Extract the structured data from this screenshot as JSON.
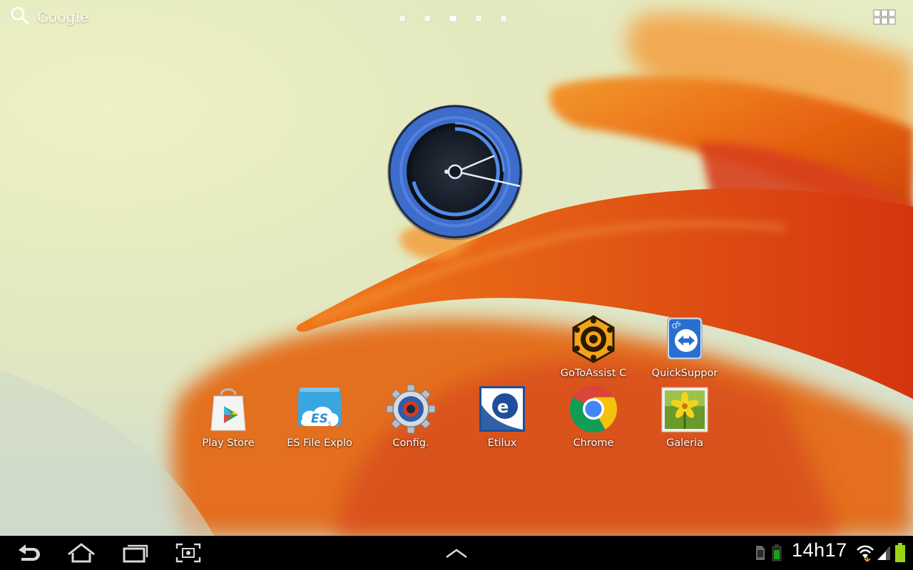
{
  "search": {
    "label": "Google",
    "icon": "search-icon"
  },
  "pager": {
    "page_count": 5,
    "active_index": 2
  },
  "apps_button": {
    "icon": "apps-grid-icon"
  },
  "clock_widget": {
    "icon": "analog-clock-icon",
    "accent": "#4a7fd8"
  },
  "apps": {
    "gotoassist": {
      "label": "GoToAssist C",
      "icon": "gotoassist-gear-icon"
    },
    "quicksupport": {
      "label": "QuickSuppor",
      "icon": "teamviewer-quicksupport-icon"
    },
    "play_store": {
      "label": "Play Store",
      "icon": "play-store-icon"
    },
    "es_file": {
      "label": "ES File Explo",
      "icon": "es-file-explorer-icon"
    },
    "config": {
      "label": "Config.",
      "icon": "settings-gear-icon"
    },
    "etilux": {
      "label": "Etilux",
      "icon": "etilux-icon"
    },
    "chrome": {
      "label": "Chrome",
      "icon": "chrome-icon"
    },
    "galeria": {
      "label": "Galeria",
      "icon": "gallery-icon"
    }
  },
  "system_bar": {
    "back": "back-icon",
    "home": "home-icon",
    "recents": "recent-apps-icon",
    "screenshot": "screenshot-icon",
    "app_drawer_arrow": "chevron-up-icon",
    "time": "14h17",
    "sd_icon": "sd-card-icon",
    "battery_small": "battery-small-icon",
    "wifi_icon": "wifi-icon",
    "signal_icon": "signal-icon",
    "battery_icon": "battery-icon"
  }
}
